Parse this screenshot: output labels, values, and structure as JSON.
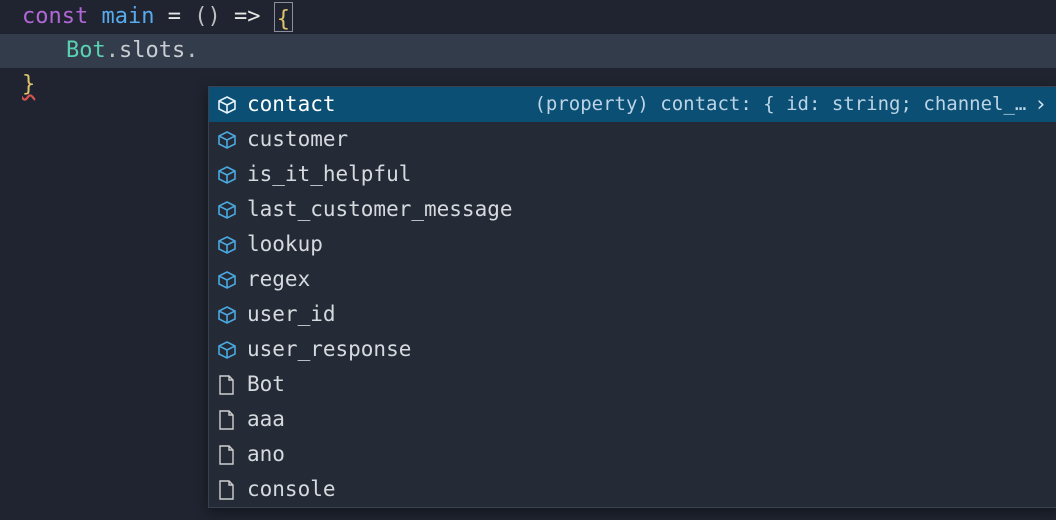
{
  "code": {
    "line1": {
      "kw": "const ",
      "fn": "main",
      "assign": " = ",
      "paren": "()",
      "arrow": " => ",
      "brace": "{"
    },
    "line2": {
      "obj": "Bot",
      "dot1": ".",
      "prop": "slots",
      "dot2": "."
    },
    "line3": {
      "brace": "}"
    }
  },
  "suggest": {
    "items": [
      {
        "icon": "prop",
        "label": "contact",
        "selected": true,
        "detail": "(property) contact: { id: string; channel_…",
        "more": "›"
      },
      {
        "icon": "prop",
        "label": "customer"
      },
      {
        "icon": "prop",
        "label": "is_it_helpful"
      },
      {
        "icon": "prop",
        "label": "last_customer_message"
      },
      {
        "icon": "prop",
        "label": "lookup"
      },
      {
        "icon": "prop",
        "label": "regex"
      },
      {
        "icon": "prop",
        "label": "user_id"
      },
      {
        "icon": "prop",
        "label": "user_response"
      },
      {
        "icon": "file",
        "label": "Bot"
      },
      {
        "icon": "file",
        "label": "aaa"
      },
      {
        "icon": "file",
        "label": "ano"
      },
      {
        "icon": "file",
        "label": "console"
      }
    ]
  }
}
